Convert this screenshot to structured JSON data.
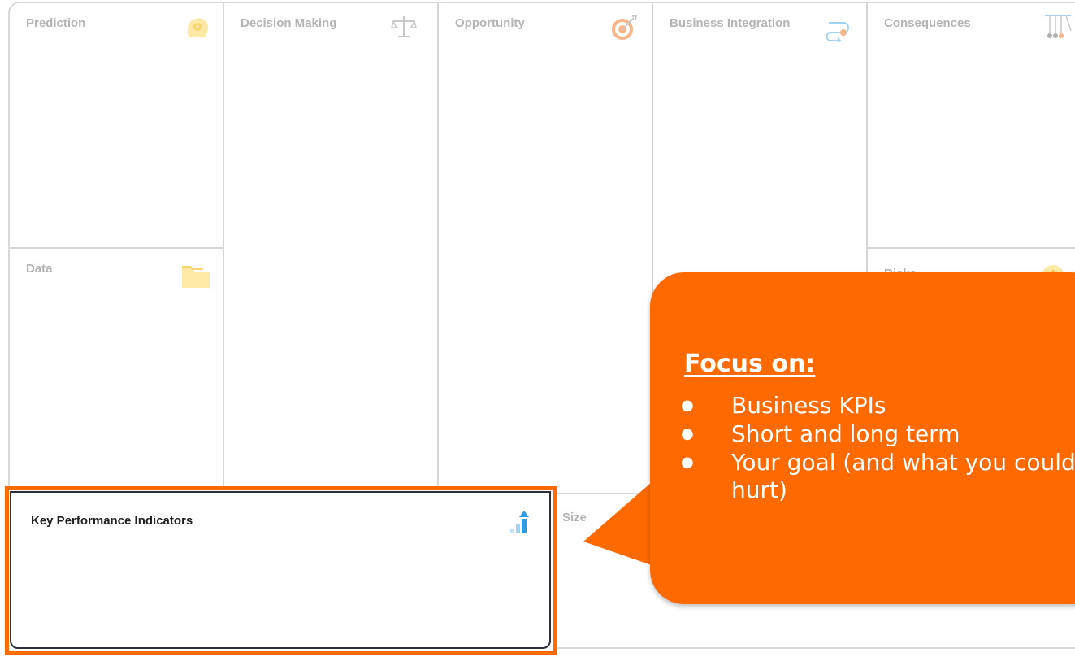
{
  "canvas": {
    "cells": {
      "prediction": {
        "title": "Prediction",
        "icon": "head-gear-icon"
      },
      "data": {
        "title": "Data",
        "icon": "folder-icon"
      },
      "decision_making": {
        "title": "Decision Making",
        "icon": "scales-icon"
      },
      "opportunity": {
        "title": "Opportunity",
        "icon": "target-icon"
      },
      "business_integration": {
        "title": "Business Integration",
        "icon": "flow-arrows-icon"
      },
      "consequences": {
        "title": "Consequences",
        "icon": "pendulum-icon"
      },
      "risks": {
        "title": "Risks",
        "icon": "warning-icon"
      },
      "size": {
        "title": "Size"
      },
      "kpi": {
        "title": "Key Performance Indicators",
        "icon": "chart-up-icon"
      }
    }
  },
  "callout": {
    "heading": "Focus on:",
    "bullets": [
      "Business KPIs",
      "Short and long term",
      "Your goal (and what you could hurt)"
    ]
  },
  "colors": {
    "accent": "#ff6a00",
    "icon_yellow": "#fde8a6",
    "icon_blue": "#2f9be0"
  }
}
